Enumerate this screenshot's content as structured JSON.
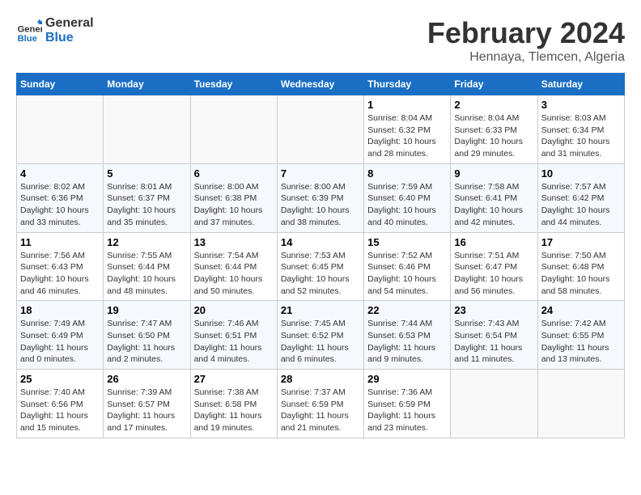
{
  "header": {
    "logo_line1": "General",
    "logo_line2": "Blue",
    "month_year": "February 2024",
    "location": "Hennaya, Tlemcen, Algeria"
  },
  "days_of_week": [
    "Sunday",
    "Monday",
    "Tuesday",
    "Wednesday",
    "Thursday",
    "Friday",
    "Saturday"
  ],
  "weeks": [
    {
      "cells": [
        {
          "day": "",
          "content": ""
        },
        {
          "day": "",
          "content": ""
        },
        {
          "day": "",
          "content": ""
        },
        {
          "day": "",
          "content": ""
        },
        {
          "day": "1",
          "content": "Sunrise: 8:04 AM\nSunset: 6:32 PM\nDaylight: 10 hours and 28 minutes."
        },
        {
          "day": "2",
          "content": "Sunrise: 8:04 AM\nSunset: 6:33 PM\nDaylight: 10 hours and 29 minutes."
        },
        {
          "day": "3",
          "content": "Sunrise: 8:03 AM\nSunset: 6:34 PM\nDaylight: 10 hours and 31 minutes."
        }
      ]
    },
    {
      "cells": [
        {
          "day": "4",
          "content": "Sunrise: 8:02 AM\nSunset: 6:36 PM\nDaylight: 10 hours and 33 minutes."
        },
        {
          "day": "5",
          "content": "Sunrise: 8:01 AM\nSunset: 6:37 PM\nDaylight: 10 hours and 35 minutes."
        },
        {
          "day": "6",
          "content": "Sunrise: 8:00 AM\nSunset: 6:38 PM\nDaylight: 10 hours and 37 minutes."
        },
        {
          "day": "7",
          "content": "Sunrise: 8:00 AM\nSunset: 6:39 PM\nDaylight: 10 hours and 38 minutes."
        },
        {
          "day": "8",
          "content": "Sunrise: 7:59 AM\nSunset: 6:40 PM\nDaylight: 10 hours and 40 minutes."
        },
        {
          "day": "9",
          "content": "Sunrise: 7:58 AM\nSunset: 6:41 PM\nDaylight: 10 hours and 42 minutes."
        },
        {
          "day": "10",
          "content": "Sunrise: 7:57 AM\nSunset: 6:42 PM\nDaylight: 10 hours and 44 minutes."
        }
      ]
    },
    {
      "cells": [
        {
          "day": "11",
          "content": "Sunrise: 7:56 AM\nSunset: 6:43 PM\nDaylight: 10 hours and 46 minutes."
        },
        {
          "day": "12",
          "content": "Sunrise: 7:55 AM\nSunset: 6:44 PM\nDaylight: 10 hours and 48 minutes."
        },
        {
          "day": "13",
          "content": "Sunrise: 7:54 AM\nSunset: 6:44 PM\nDaylight: 10 hours and 50 minutes."
        },
        {
          "day": "14",
          "content": "Sunrise: 7:53 AM\nSunset: 6:45 PM\nDaylight: 10 hours and 52 minutes."
        },
        {
          "day": "15",
          "content": "Sunrise: 7:52 AM\nSunset: 6:46 PM\nDaylight: 10 hours and 54 minutes."
        },
        {
          "day": "16",
          "content": "Sunrise: 7:51 AM\nSunset: 6:47 PM\nDaylight: 10 hours and 56 minutes."
        },
        {
          "day": "17",
          "content": "Sunrise: 7:50 AM\nSunset: 6:48 PM\nDaylight: 10 hours and 58 minutes."
        }
      ]
    },
    {
      "cells": [
        {
          "day": "18",
          "content": "Sunrise: 7:49 AM\nSunset: 6:49 PM\nDaylight: 11 hours and 0 minutes."
        },
        {
          "day": "19",
          "content": "Sunrise: 7:47 AM\nSunset: 6:50 PM\nDaylight: 11 hours and 2 minutes."
        },
        {
          "day": "20",
          "content": "Sunrise: 7:46 AM\nSunset: 6:51 PM\nDaylight: 11 hours and 4 minutes."
        },
        {
          "day": "21",
          "content": "Sunrise: 7:45 AM\nSunset: 6:52 PM\nDaylight: 11 hours and 6 minutes."
        },
        {
          "day": "22",
          "content": "Sunrise: 7:44 AM\nSunset: 6:53 PM\nDaylight: 11 hours and 9 minutes."
        },
        {
          "day": "23",
          "content": "Sunrise: 7:43 AM\nSunset: 6:54 PM\nDaylight: 11 hours and 11 minutes."
        },
        {
          "day": "24",
          "content": "Sunrise: 7:42 AM\nSunset: 6:55 PM\nDaylight: 11 hours and 13 minutes."
        }
      ]
    },
    {
      "cells": [
        {
          "day": "25",
          "content": "Sunrise: 7:40 AM\nSunset: 6:56 PM\nDaylight: 11 hours and 15 minutes."
        },
        {
          "day": "26",
          "content": "Sunrise: 7:39 AM\nSunset: 6:57 PM\nDaylight: 11 hours and 17 minutes."
        },
        {
          "day": "27",
          "content": "Sunrise: 7:38 AM\nSunset: 6:58 PM\nDaylight: 11 hours and 19 minutes."
        },
        {
          "day": "28",
          "content": "Sunrise: 7:37 AM\nSunset: 6:59 PM\nDaylight: 11 hours and 21 minutes."
        },
        {
          "day": "29",
          "content": "Sunrise: 7:36 AM\nSunset: 6:59 PM\nDaylight: 11 hours and 23 minutes."
        },
        {
          "day": "",
          "content": ""
        },
        {
          "day": "",
          "content": ""
        }
      ]
    }
  ]
}
